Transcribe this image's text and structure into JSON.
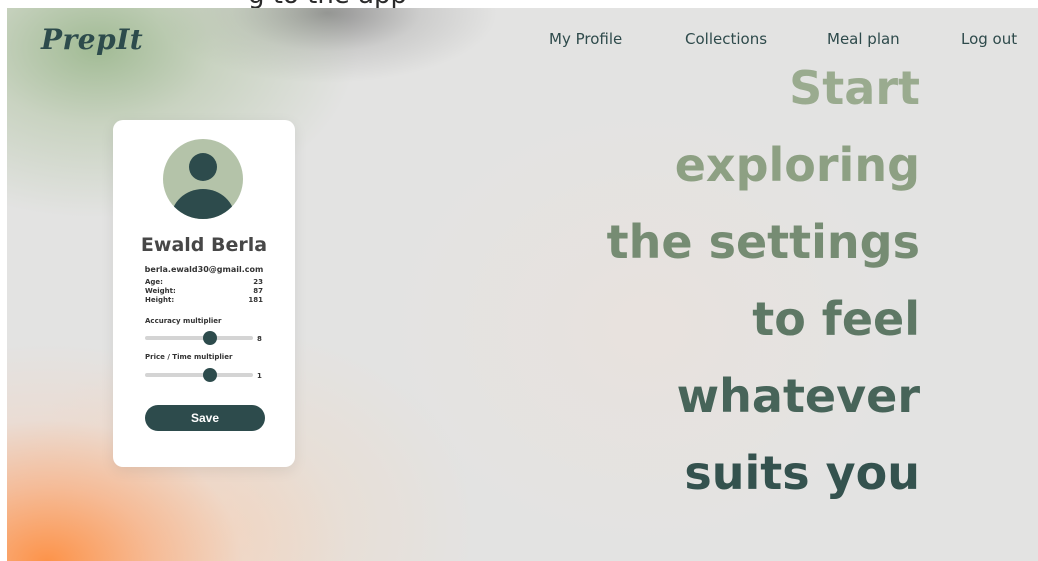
{
  "app": {
    "logo": "PrepIt",
    "top_strip_text": "g to the app"
  },
  "nav": {
    "items": [
      {
        "label": "My Profile"
      },
      {
        "label": "Collections"
      },
      {
        "label": "Meal plan"
      },
      {
        "label": "Log out"
      }
    ]
  },
  "profile": {
    "name": "Ewald Berla",
    "email": "berla.ewald30@gmail.com",
    "stats": [
      {
        "label": "Age:",
        "value": "23"
      },
      {
        "label": "Weight:",
        "value": "87"
      },
      {
        "label": "Height:",
        "value": "181"
      }
    ],
    "sliders": [
      {
        "label": "Accuracy multiplier",
        "value": "8",
        "position_fraction": 0.6
      },
      {
        "label": "Price / Time multiplier",
        "value": "1",
        "position_fraction": 0.6
      }
    ],
    "save_label": "Save"
  },
  "headline": {
    "lines": [
      "Start",
      "exploring",
      "the settings",
      "to feel",
      "whatever",
      "suits you"
    ]
  },
  "colors": {
    "brand_dark": "#2d4b4c",
    "avatar_bg": "#b4c3a9",
    "headline_start": "#9aab8f",
    "headline_end": "#34524e"
  },
  "icons": {
    "avatar": "user-silhouette-icon"
  }
}
